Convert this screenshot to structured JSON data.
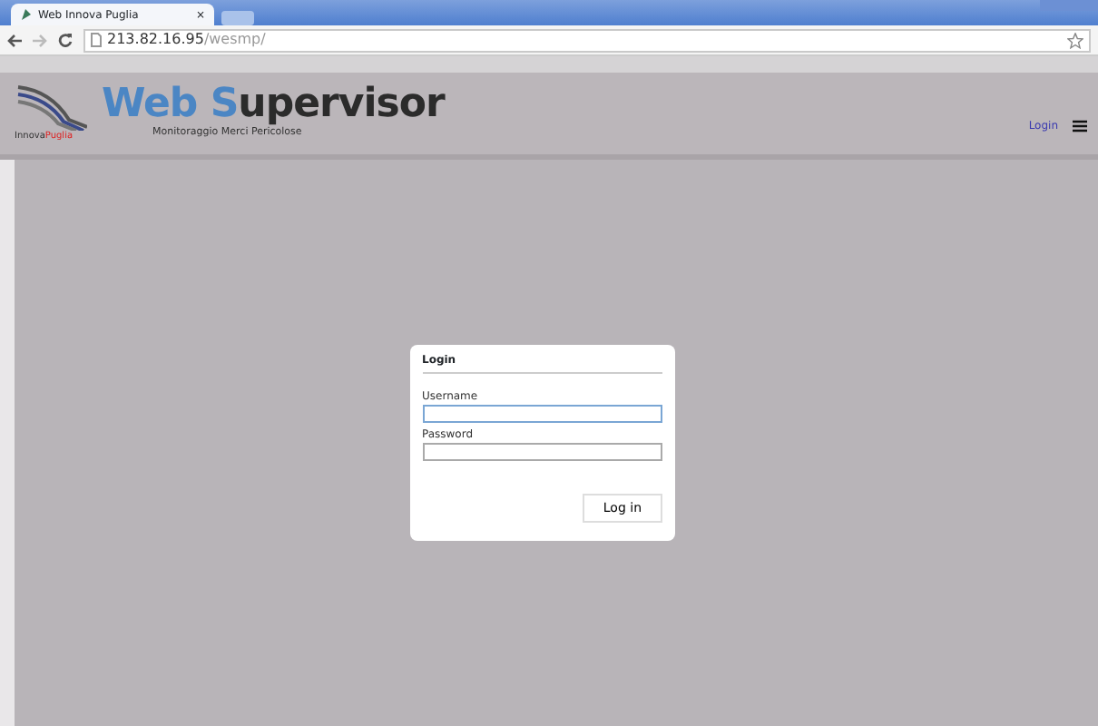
{
  "browser": {
    "tab_title": "Web Innova Puglia",
    "tab_close": "×",
    "address_host": "213.82.16.95",
    "address_path": "/wesmp/"
  },
  "header": {
    "logo_brand": [
      "Innova",
      "Puglia"
    ],
    "title_parts": [
      "Web",
      "S",
      "upervisor"
    ],
    "subtitle": "Monitoraggio Merci Pericolose",
    "login_link": "Login"
  },
  "login": {
    "title": "Login",
    "fields": [
      {
        "label": "Username",
        "focused": true
      },
      {
        "label": "Password",
        "focused": false
      }
    ],
    "button": "Log in"
  }
}
